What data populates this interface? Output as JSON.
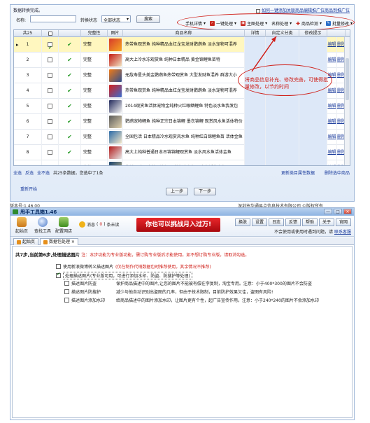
{
  "win1": {
    "status": "数据转换完成。",
    "plugin_link": "如何一键添加关联商品编辑推广位商品到推广位",
    "search": {
      "name_label": "名称:",
      "name_value": "",
      "status_label": "转换状态",
      "status_value": "全部状态",
      "search_btn": "搜索"
    },
    "tools": [
      "手机详情",
      "一键处理",
      "主图处理",
      "名称处理",
      "商品检测",
      "批量修改"
    ],
    "columns": [
      "共25",
      "完整性",
      "图片",
      "商品名称",
      "详情",
      "自定义分类",
      "修改提示"
    ],
    "rows": [
      {
        "num": "1",
        "status": "完整",
        "name": "热带鱼观赏鱼 纯种精品血红龙宝发财鹦鹉鱼 淡水宠物可混养",
        "edit": "编辑",
        "del": "删除"
      },
      {
        "num": "2",
        "status": "完整",
        "name": "高大上冷水冻观赏鱼 纯种日本精品 黄金锦鲤鱼苗特",
        "edit": "编辑",
        "del": "删除"
      },
      {
        "num": "3",
        "status": "完整",
        "name": "无敌寿星头美金鹦鹉鱼热带观赏鱼 大型发财鱼混养 群游大小",
        "edit": "编辑",
        "del": "删除"
      },
      {
        "num": "4",
        "status": "完整",
        "name": "热带鱼观赏鱼 纯种精品血红龙宝发财鹦鹉鱼 淡水宠物可混养",
        "edit": "编辑",
        "del": "删除"
      },
      {
        "num": "5",
        "status": "完整",
        "name": "2014观赏鱼活体宠物金纯种火红眼鳞鲤鱼 特色淡水鱼我发包",
        "edit": "编辑",
        "del": "删除"
      },
      {
        "num": "6",
        "status": "完整",
        "name": "鹦鹉宠物鲤鱼 纯种正宗日本锦鲤 墨衣锦鲤 观赏风水鱼活体特价",
        "edit": "编辑",
        "del": "删除"
      },
      {
        "num": "7",
        "status": "完整",
        "name": "全国包活 日本精品冷水观赏风水鱼 纯种红白锦鲤鱼苗 活体金鱼",
        "edit": "编辑",
        "del": "删除"
      },
      {
        "num": "8",
        "status": "完整",
        "name": "高大上纯种普通日本吊锦锦鲤观赏鱼 淡水风水鱼活体金鱼",
        "edit": "编辑",
        "del": "删除"
      },
      {
        "num": "9",
        "status": "完整",
        "name": "热销 日本正宗精品锦鲤 观赏鱼冷水鱼 风水鱼活体金鱼",
        "edit": "编辑",
        "del": "删除"
      }
    ],
    "annotation": "将商品信息补充、修改完善，可使得批量修改，以节约时间",
    "footer": {
      "select_all": "全选",
      "invert": "反选",
      "all": "全不选",
      "summary": "共25条数据，您选中了1条",
      "link_right1": "更新类目属性数据",
      "link_right2": "删除选中商品"
    },
    "restart": "重新开始",
    "prev": "上一步",
    "next": "下一步"
  },
  "version_line": "版本号:1.46.00",
  "copyright": "深圳市华通易点信息技术有限公司 ©版权所有",
  "win2": {
    "title": "甩手工具箱1.46",
    "window_buttons": [
      "—",
      "□",
      "×"
    ],
    "tools": [
      "起始页",
      "查找工具",
      "配置网店"
    ],
    "messages_label": "消息",
    "messages_count": "0",
    "messages_suffix": "条未读",
    "banner": "你也可以挑战月入过万!",
    "topbuttons": [
      "换肤",
      "设置",
      "日志",
      "反馈",
      "帮助",
      "关于",
      "官网"
    ],
    "support_text": "不会使用或使用时遇到问题，请",
    "support_link": "联系客服",
    "tabs": [
      "起始页",
      "数据包处理"
    ],
    "step_title": "共7步,当前第6步,处理描述图片",
    "step_note": "注：本步功能为专业版功能，需订购专业版后才能使用。如不想订购专业版，请取消勾选。",
    "opt1": "使用新浪微博转义描述图片",
    "opt1_note": "(仅在制作代销数据包时推荐使用，其余情况不推荐)",
    "opt2": "处理描述图片(专业版可用，可进行添加水印、防盗、防搜护等处理)",
    "sub_options": [
      {
        "label": "描述图片防盗",
        "desc": "保护商品描述中的图片,让您的图片不能被有偿在李复制，淘宝专用。注意：小于400*300的图片不会防盗"
      },
      {
        "label": "描述图片防搜护",
        "desc": "减少与他自动识别出盗图的几率，但由于技术限制，目前防护效果欠佳，盗图有风险!"
      },
      {
        "label": "描述图片添加水印",
        "desc": "给商品描述中的图片添加水印，让图片更有个性，起广告宣传作用。注意：小于240*240的图片不会添加水印"
      }
    ]
  }
}
